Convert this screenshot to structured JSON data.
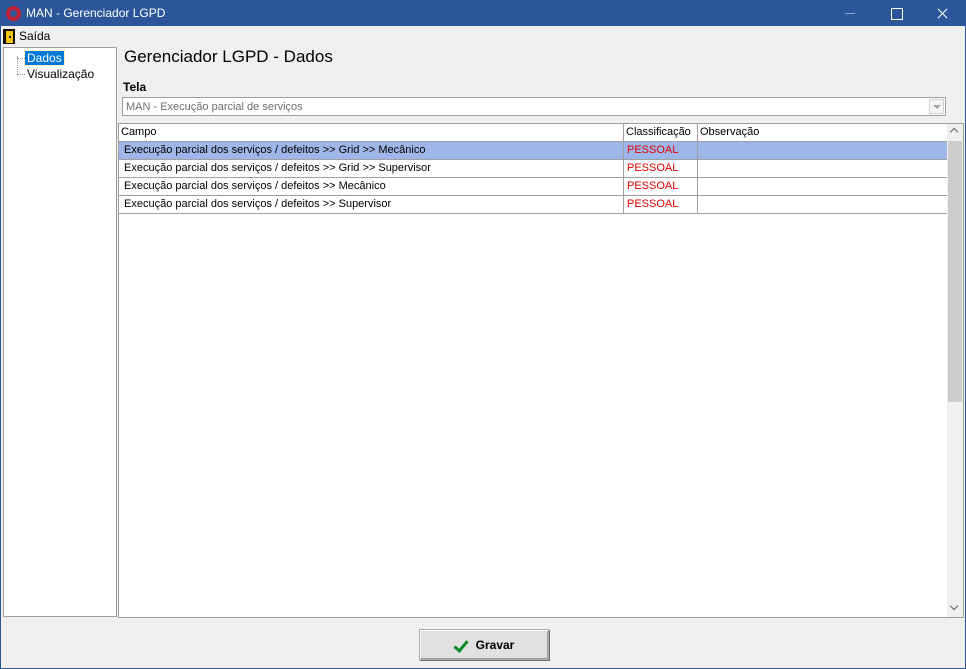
{
  "window": {
    "title": "MAN - Gerenciador LGPD"
  },
  "menu": {
    "exit_label": "Saída"
  },
  "tree": {
    "items": [
      {
        "label": "Dados",
        "selected": true
      },
      {
        "label": "Visualização",
        "selected": false
      }
    ]
  },
  "main": {
    "heading": "Gerenciador LGPD - Dados",
    "tela_label": "Tela",
    "tela_value": "MAN - Execução parcial de serviços"
  },
  "grid": {
    "columns": [
      "Campo",
      "Classificação",
      "Observação"
    ],
    "rows": [
      {
        "campo": "Execução parcial dos serviços / defeitos >> Grid >> Mecânico",
        "classificacao": "PESSOAL",
        "observacao": "",
        "selected": true
      },
      {
        "campo": "Execução parcial dos serviços / defeitos >> Grid >> Supervisor",
        "classificacao": "PESSOAL",
        "observacao": "",
        "selected": false
      },
      {
        "campo": "Execução parcial dos serviços / defeitos >> Mecânico",
        "classificacao": "PESSOAL",
        "observacao": "",
        "selected": false
      },
      {
        "campo": "Execução parcial dos serviços / defeitos >> Supervisor",
        "classificacao": "PESSOAL",
        "observacao": "",
        "selected": false
      }
    ]
  },
  "footer": {
    "save_label": "Gravar"
  },
  "icons": {
    "app": "app-logo-icon",
    "exit": "exit-door-icon",
    "save": "checkmark-icon"
  },
  "colors": {
    "titlebar": "#2b579a",
    "selection": "#0078d7",
    "row_selected": "#9fb6e8",
    "classification_text": "#e00000"
  }
}
